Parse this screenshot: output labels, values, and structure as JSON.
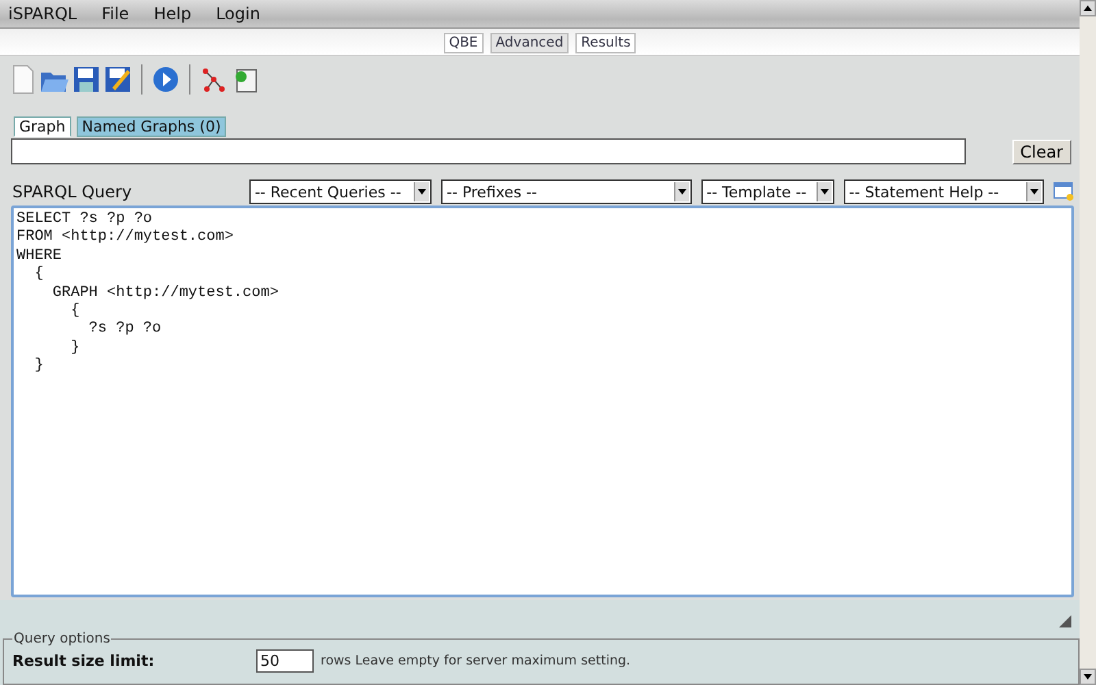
{
  "menu_bar": [
    "iSPARQL",
    "File",
    "Help",
    "Login"
  ],
  "view_tabs": [
    {
      "label": "QBE",
      "selected": false
    },
    {
      "label": "Advanced",
      "selected": true
    },
    {
      "label": "Results",
      "selected": false
    }
  ],
  "toolbar": [
    {
      "kind": "new"
    },
    {
      "kind": "open"
    },
    {
      "kind": "save"
    },
    {
      "kind": "save-as"
    },
    {
      "kind": "separator"
    },
    {
      "kind": "run"
    },
    {
      "kind": "separator"
    },
    {
      "kind": "graph"
    },
    {
      "kind": "import"
    }
  ],
  "graph_tabs": [
    {
      "label": "Graph",
      "selected": true
    },
    {
      "label": "Named Graphs (0)",
      "selected": false
    }
  ],
  "clear_button": "Clear",
  "query_label": "SPARQL Query",
  "dropdowns": [
    "-- Recent Queries --",
    "-- Prefixes --",
    "-- Template --",
    "-- Statement Help --"
  ],
  "query": "SELECT ?s ?p ?o\nFROM <http://mytest.com>\nWHERE\n  {\n    GRAPH <http://mytest.com>\n      {\n        ?s ?p ?o\n      }\n  }",
  "query_options": {
    "legend": "Query options",
    "result_limit_label": "Result size limit:",
    "result_limit_value": "50",
    "result_limit_hint": "rows Leave empty for server maximum setting."
  }
}
